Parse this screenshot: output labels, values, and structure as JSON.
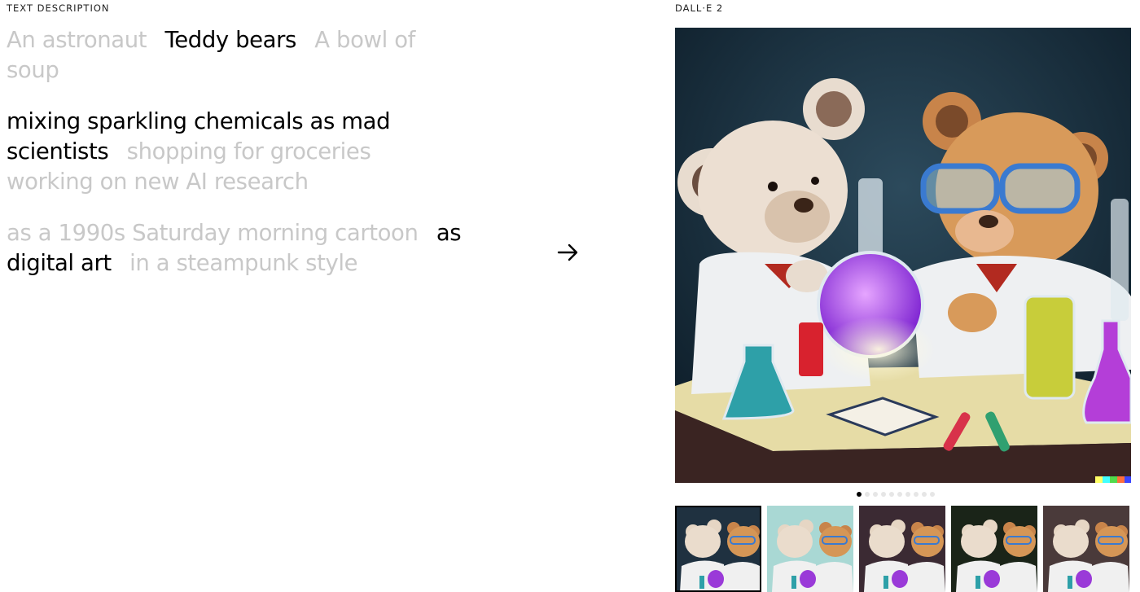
{
  "left_panel": {
    "label": "TEXT DESCRIPTION",
    "subjects": [
      {
        "text": "An astronaut",
        "selected": false
      },
      {
        "text": "Teddy bears",
        "selected": true
      },
      {
        "text": "A bowl of soup",
        "selected": false
      }
    ],
    "actions": [
      {
        "text": "mixing sparkling chemicals as mad scientists",
        "selected": true
      },
      {
        "text": "shopping for groceries",
        "selected": false
      },
      {
        "text": "working on new AI research",
        "selected": false
      }
    ],
    "styles": [
      {
        "text": "as a 1990s Saturday morning cartoon",
        "selected": false
      },
      {
        "text": "as digital art",
        "selected": true
      },
      {
        "text": "in a steampunk style",
        "selected": false
      }
    ],
    "arrow_icon": "arrow-right-icon"
  },
  "right_panel": {
    "label": "DALL·E 2",
    "main_image_icon": "teddy-bears-mad-scientists-image",
    "carousel": {
      "total": 10,
      "active": 1
    },
    "thumbnails": [
      {
        "icon": "thumbnail-image",
        "selected": true,
        "bg": "#1f3140"
      },
      {
        "icon": "thumbnail-image",
        "selected": false,
        "bg": "#a9d8d4"
      },
      {
        "icon": "thumbnail-image",
        "selected": false,
        "bg": "#3b2a33"
      },
      {
        "icon": "thumbnail-image",
        "selected": false,
        "bg": "#1a2418"
      },
      {
        "icon": "thumbnail-image",
        "selected": false,
        "bg": "#4a3a3a"
      }
    ],
    "watermark_colors": [
      "#ffff66",
      "#42ffff",
      "#51da4c",
      "#ff6e3c",
      "#3c46ff"
    ]
  }
}
